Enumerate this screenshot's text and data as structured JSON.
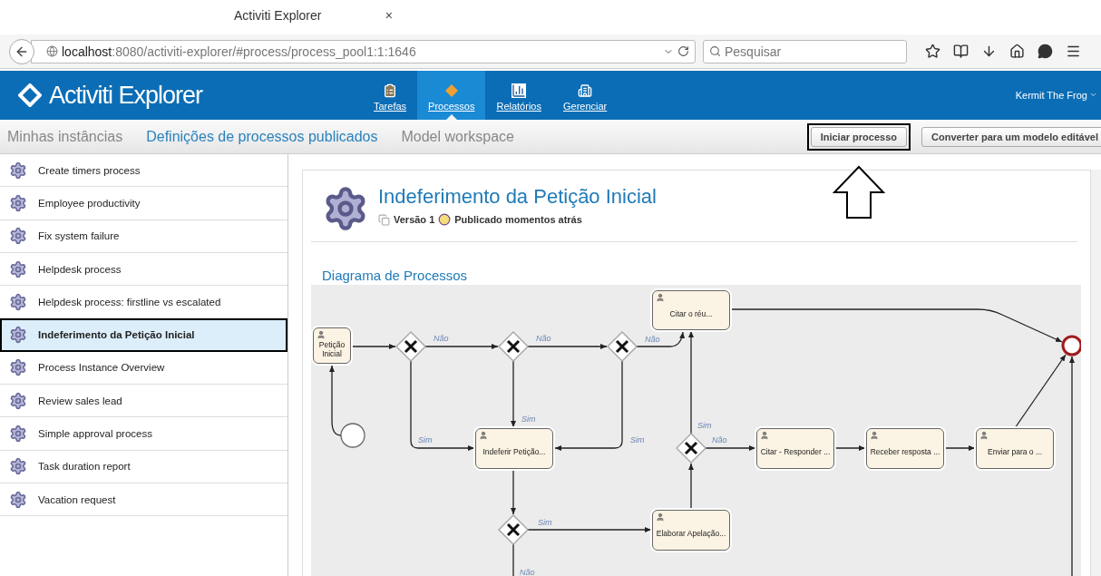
{
  "browser": {
    "tab": {
      "title": "Activiti Explorer",
      "close": "×"
    },
    "url": {
      "host": "localhost",
      "path": ":8080/activiti-explorer/#process/process_pool1:1:1646"
    },
    "search": {
      "placeholder": "Pesquisar"
    }
  },
  "header": {
    "logo": "Activiti Explorer",
    "user": "Kermit The Frog",
    "nav": [
      {
        "label": "Tarefas",
        "kind": "tasks",
        "selected": false
      },
      {
        "label": "Processos",
        "kind": "processes",
        "selected": true
      },
      {
        "label": "Relatórios",
        "kind": "reports",
        "selected": false
      },
      {
        "label": "Gerenciar",
        "kind": "manage",
        "selected": false
      }
    ]
  },
  "subnav": {
    "tabs": [
      {
        "label": "Minhas instâncias",
        "selected": false
      },
      {
        "label": "Definições de processos publicados",
        "selected": true
      },
      {
        "label": "Model workspace",
        "selected": false
      }
    ],
    "buttons": [
      {
        "label": "Iniciar processo",
        "highlighted": true
      },
      {
        "label": "Converter para um modelo editável",
        "highlighted": false
      }
    ]
  },
  "sidebar": {
    "items": [
      {
        "label": "Create timers process",
        "selected": false,
        "highlighted": false
      },
      {
        "label": "Employee productivity",
        "selected": false,
        "highlighted": false
      },
      {
        "label": "Fix system failure",
        "selected": false,
        "highlighted": false
      },
      {
        "label": "Helpdesk process",
        "selected": false,
        "highlighted": false
      },
      {
        "label": "Helpdesk process: firstline vs escalated",
        "selected": false,
        "highlighted": false
      },
      {
        "label": "Indeferimento da Petição Inicial",
        "selected": true,
        "highlighted": true
      },
      {
        "label": "Process Instance Overview",
        "selected": false,
        "highlighted": false
      },
      {
        "label": "Review sales lead",
        "selected": false,
        "highlighted": false
      },
      {
        "label": "Simple approval process",
        "selected": false,
        "highlighted": false
      },
      {
        "label": "Task duration report",
        "selected": false,
        "highlighted": false
      },
      {
        "label": "Vacation request",
        "selected": false,
        "highlighted": false
      }
    ]
  },
  "process": {
    "title": "Indeferimento da Petição Inicial",
    "version": "Versão 1",
    "published": "Publicado momentos atrás",
    "diagram_title": "Diagrama de Processos",
    "diagram": {
      "nodes": [
        {
          "kind": "task",
          "label": "Petição Inicial"
        },
        {
          "kind": "start"
        },
        {
          "kind": "gateway"
        },
        {
          "kind": "gateway"
        },
        {
          "kind": "gateway"
        },
        {
          "kind": "task",
          "label": "Citar o réu..."
        },
        {
          "kind": "task",
          "label": "Indeferir Petição..."
        },
        {
          "kind": "gateway"
        },
        {
          "kind": "task",
          "label": "Elaborar Apelação..."
        },
        {
          "kind": "gateway"
        },
        {
          "kind": "task",
          "label": "Citar - Responder ..."
        },
        {
          "kind": "task",
          "label": "Receber resposta ..."
        },
        {
          "kind": "task",
          "label": "Enviar para o ..."
        },
        {
          "kind": "end"
        }
      ],
      "flow_labels": [
        "Não",
        "Não",
        "Não",
        "Sim",
        "Sim",
        "Sim",
        "Sim",
        "Não",
        "Sim",
        "Não"
      ]
    }
  }
}
